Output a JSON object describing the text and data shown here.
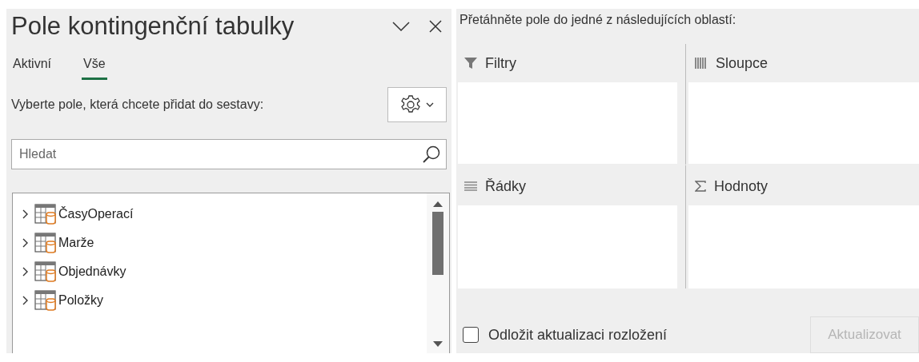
{
  "panel": {
    "title": "Pole kontingenční tabulky"
  },
  "tabs": [
    {
      "label": "Aktivní",
      "selected": false
    },
    {
      "label": "Vše",
      "selected": true
    }
  ],
  "field_prompt": "Vyberte pole, která chcete přidat do sestavy:",
  "search": {
    "placeholder": "Hledat"
  },
  "tables": [
    {
      "name": "ČasyOperací",
      "expanded": false
    },
    {
      "name": "Marže",
      "expanded": false
    },
    {
      "name": "Objednávky",
      "expanded": false
    },
    {
      "name": "Položky",
      "expanded": false
    }
  ],
  "areas_prompt": "Přetáhněte pole do jedné z následujících oblastí:",
  "areas": [
    {
      "kind": "filters",
      "label": "Filtry"
    },
    {
      "kind": "columns",
      "label": "Sloupce"
    },
    {
      "kind": "rows",
      "label": "Řádky"
    },
    {
      "kind": "values",
      "label": "Hodnoty"
    }
  ],
  "defer": {
    "label": "Odložit aktualizaci rozložení",
    "checked": false
  },
  "update_button": {
    "label": "Aktualizovat",
    "disabled": true
  }
}
